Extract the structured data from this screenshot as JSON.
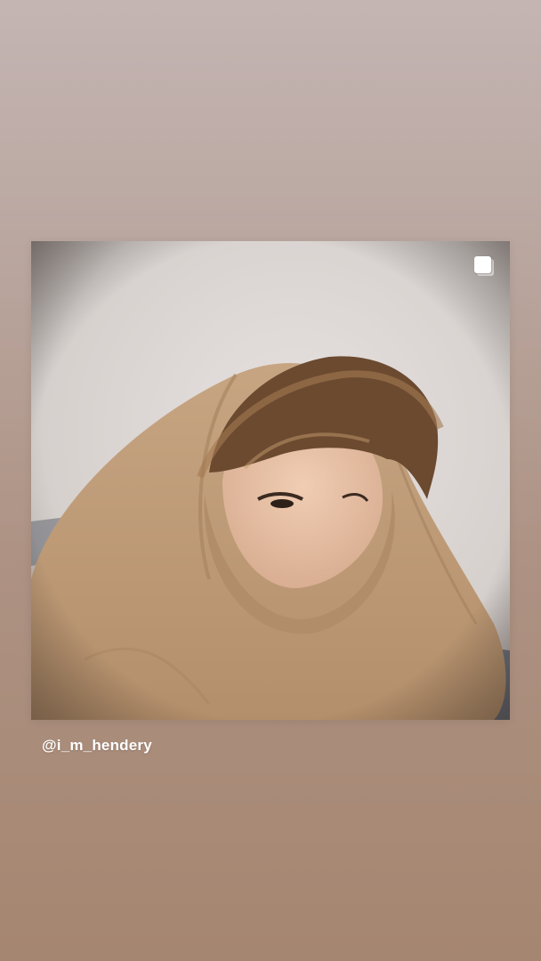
{
  "story": {
    "post": {
      "photo_icon": "photo-portrait",
      "multiple_posts_icon": "carousel-icon"
    },
    "mention": "@i_m_hendery"
  },
  "colors": {
    "background_top": "#c4b5b3",
    "background_bottom": "#a58670",
    "mention_text": "#ffffff"
  }
}
